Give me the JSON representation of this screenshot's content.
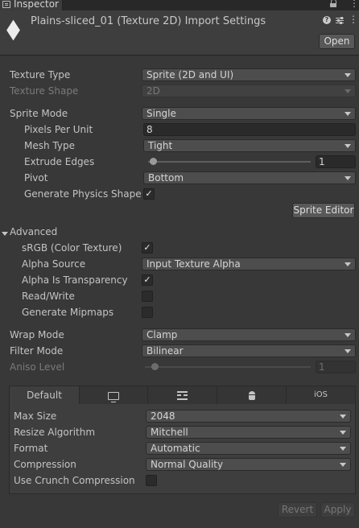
{
  "window": {
    "tab_label": "Inspector",
    "tab_icon": "inspector-icon",
    "menu_glyph": "⋮"
  },
  "header": {
    "title": "Plains-sliced_01 (Texture 2D) Import Settings",
    "icon": "sprite-asset-icon",
    "help_glyph": "?",
    "menu_glyph": "⋮",
    "open_label": "Open"
  },
  "texture": {
    "type_label": "Texture Type",
    "type_value": "Sprite (2D and UI)",
    "shape_label": "Texture Shape",
    "shape_value": "2D"
  },
  "sprite": {
    "mode_label": "Sprite Mode",
    "mode_value": "Single",
    "ppu_label": "Pixels Per Unit",
    "ppu_value": "8",
    "mesh_label": "Mesh Type",
    "mesh_value": "Tight",
    "extrude_label": "Extrude Edges",
    "extrude_value": "1",
    "pivot_label": "Pivot",
    "pivot_value": "Bottom",
    "physics_label": "Generate Physics Shape",
    "physics_checked": true,
    "editor_button": "Sprite Editor"
  },
  "advanced": {
    "header": "Advanced",
    "srgb_label": "sRGB (Color Texture)",
    "srgb_checked": true,
    "alpha_source_label": "Alpha Source",
    "alpha_source_value": "Input Texture Alpha",
    "alpha_transparency_label": "Alpha Is Transparency",
    "alpha_transparency_checked": true,
    "readwrite_label": "Read/Write",
    "readwrite_checked": false,
    "mipmaps_label": "Generate Mipmaps",
    "mipmaps_checked": false
  },
  "wrap": {
    "wrap_label": "Wrap Mode",
    "wrap_value": "Clamp",
    "filter_label": "Filter Mode",
    "filter_value": "Bilinear",
    "aniso_label": "Aniso Level",
    "aniso_value": "1"
  },
  "platform_tabs": [
    {
      "label": "Default",
      "icon": ""
    },
    {
      "label": "",
      "icon": "monitor-icon"
    },
    {
      "label": "",
      "icon": "webgl-grid-icon"
    },
    {
      "label": "",
      "icon": "android-icon"
    },
    {
      "label": "iOS",
      "icon": ""
    }
  ],
  "platform": {
    "max_size_label": "Max Size",
    "max_size_value": "2048",
    "resize_label": "Resize Algorithm",
    "resize_value": "Mitchell",
    "format_label": "Format",
    "format_value": "Automatic",
    "compression_label": "Compression",
    "compression_value": "Normal Quality",
    "crunch_label": "Use Crunch Compression",
    "crunch_checked": false
  },
  "footer": {
    "revert_label": "Revert",
    "apply_label": "Apply"
  },
  "colors": {
    "panel_bg": "#383838",
    "header_bg": "#3e3e3e",
    "field_bg": "#2a2a2a",
    "dropdown_bg": "#4d4d4d",
    "text": "#c4c4c4",
    "disabled_text": "#7a7a7a"
  }
}
